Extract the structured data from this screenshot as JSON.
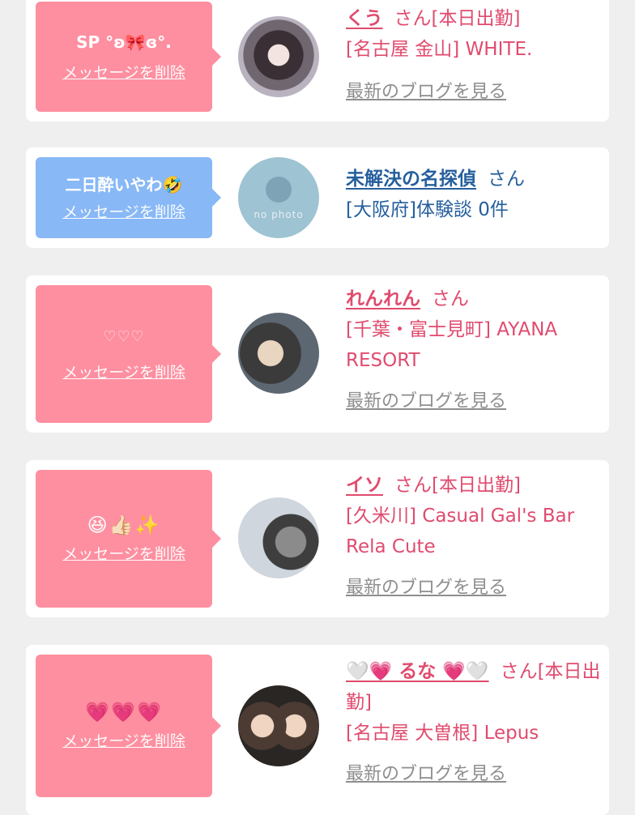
{
  "delete_label": "メッセージを削除",
  "blog_label": "最新のブログを見る",
  "honorific": "さん",
  "no_photo": "no photo",
  "colors": {
    "pink_bubble": "#fe8fa0",
    "blue_bubble": "#88b8f6",
    "pink_text": "#e04b6e",
    "blue_text": "#255f9d"
  },
  "entries": [
    {
      "message": "SP °ʚ🎀ɞ°.",
      "name": "くう",
      "suffix": "[本日出勤]",
      "shop": "[名古屋 金山] WHITE."
    },
    {
      "message": "二日酔いやわ🤣",
      "name": "未解決の名探偵",
      "shop": "[大阪府]体験談 0件"
    },
    {
      "message": "♡♡♡",
      "name": "れんれん",
      "shop": "[千葉・富士見町] AYANA RESORT"
    },
    {
      "message": "😆👍🏻✨",
      "name": "イソ",
      "suffix": "[本日出勤]",
      "shop": "[久米川] Casual Gal's Bar Rela Cute"
    },
    {
      "message": "💗💗💗",
      "name": "🤍💗 るな 💗🤍",
      "suffix": "[本日出勤]",
      "shop": "[名古屋 大曽根] Lepus"
    }
  ]
}
